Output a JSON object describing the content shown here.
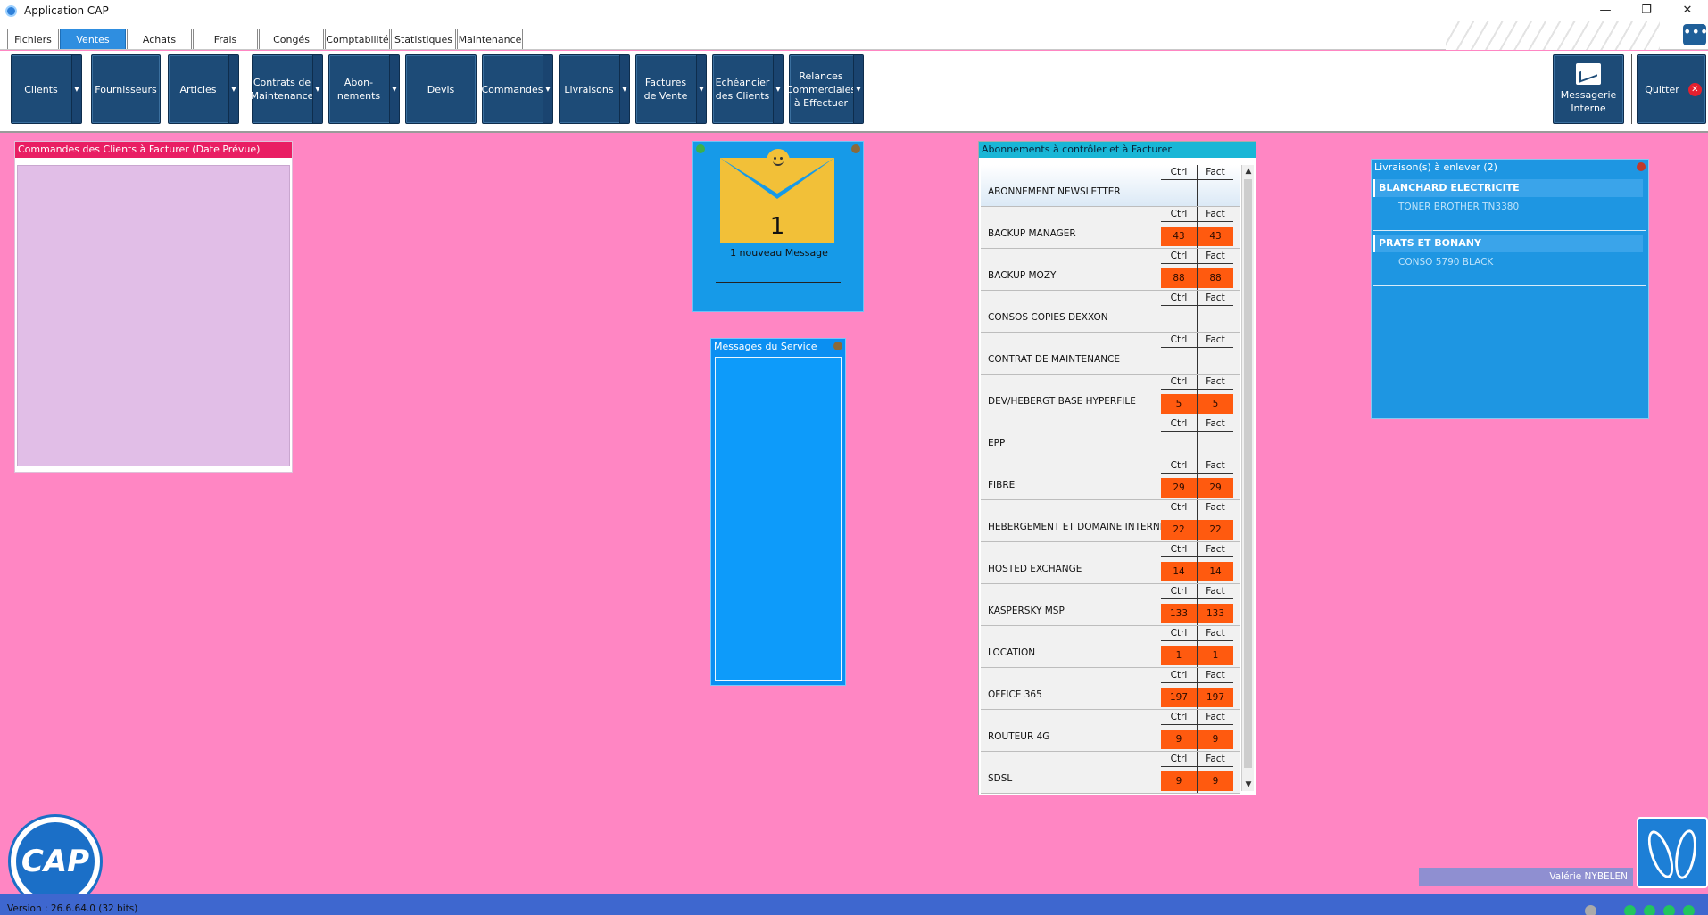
{
  "window": {
    "title": "Application CAP",
    "controls": [
      "—",
      "❐",
      "✕"
    ]
  },
  "tabs": [
    "Fichiers",
    "Ventes",
    "Achats",
    "Frais",
    "Congés",
    "Comptabilité",
    "Statistiques",
    "Maintenance"
  ],
  "active_tab": "Ventes",
  "more_label": "•••",
  "ribbon": {
    "clients": "Clients",
    "fournisseurs": "Fournisseurs",
    "articles": "Articles",
    "contrats": "Contrats de Maintenance",
    "abonnements": "Abon- nements",
    "devis": "Devis",
    "commandes": "Commandes",
    "livraisons": "Livraisons",
    "factures": "Factures de Vente",
    "echeancier": "Echéancier des Clients",
    "relances": "Relances Commerciales à Effectuer",
    "messagerie": "Messagerie Interne",
    "quitter": "Quitter",
    "dropdown_arrow": "▼",
    "close_glyph": "✕"
  },
  "panels": {
    "commandes_title": "Commandes des Clients à Facturer (Date Prévue)",
    "mail_count": "1",
    "mail_text": "1 nouveau Message",
    "messages_service_title": "Messages du Service",
    "abonnements_title": "Abonnements à contrôler et à Facturer",
    "livraisons_title": "Livraison(s) à enlever (2)"
  },
  "abonnements": {
    "col_ctrl": "Ctrl",
    "col_fact": "Fact",
    "rows": [
      {
        "name": "ABONNEMENT NEWSLETTER",
        "ctrl": "",
        "fact": ""
      },
      {
        "name": "BACKUP MANAGER",
        "ctrl": "43",
        "fact": "43"
      },
      {
        "name": "BACKUP MOZY",
        "ctrl": "88",
        "fact": "88"
      },
      {
        "name": "CONSOS COPIES DEXXON",
        "ctrl": "",
        "fact": ""
      },
      {
        "name": "CONTRAT DE MAINTENANCE",
        "ctrl": "",
        "fact": ""
      },
      {
        "name": "DEV/HEBERGT BASE HYPERFILE",
        "ctrl": "5",
        "fact": "5"
      },
      {
        "name": "EPP",
        "ctrl": "",
        "fact": ""
      },
      {
        "name": "FIBRE",
        "ctrl": "29",
        "fact": "29"
      },
      {
        "name": "HEBERGEMENT ET DOMAINE INTERNET",
        "ctrl": "22",
        "fact": "22"
      },
      {
        "name": "HOSTED EXCHANGE",
        "ctrl": "14",
        "fact": "14"
      },
      {
        "name": "KASPERSKY MSP",
        "ctrl": "133",
        "fact": "133"
      },
      {
        "name": "LOCATION",
        "ctrl": "1",
        "fact": "1"
      },
      {
        "name": "OFFICE 365",
        "ctrl": "197",
        "fact": "197"
      },
      {
        "name": "ROUTEUR 4G",
        "ctrl": "9",
        "fact": "9"
      },
      {
        "name": "SDSL",
        "ctrl": "9",
        "fact": "9"
      }
    ]
  },
  "livraisons": [
    {
      "client": "BLANCHARD ELECTRICITE",
      "article": "TONER BROTHER TN3380"
    },
    {
      "client": "PRATS ET BONANY",
      "article": "CONSO 5790 BLACK"
    }
  ],
  "scroll": {
    "up": "▲",
    "down": "▼"
  },
  "logo_text": "CAP",
  "user": "Valérie NYBELEN",
  "version": "Version : 26.6.64.0 (32 bits)",
  "colors": {
    "background": "#ff86c3",
    "ribbon_button": "#1d4b77",
    "active_tab": "#2f8ee0",
    "value_cell": "#ff5a0f",
    "status_bar": "#3e67cf"
  }
}
